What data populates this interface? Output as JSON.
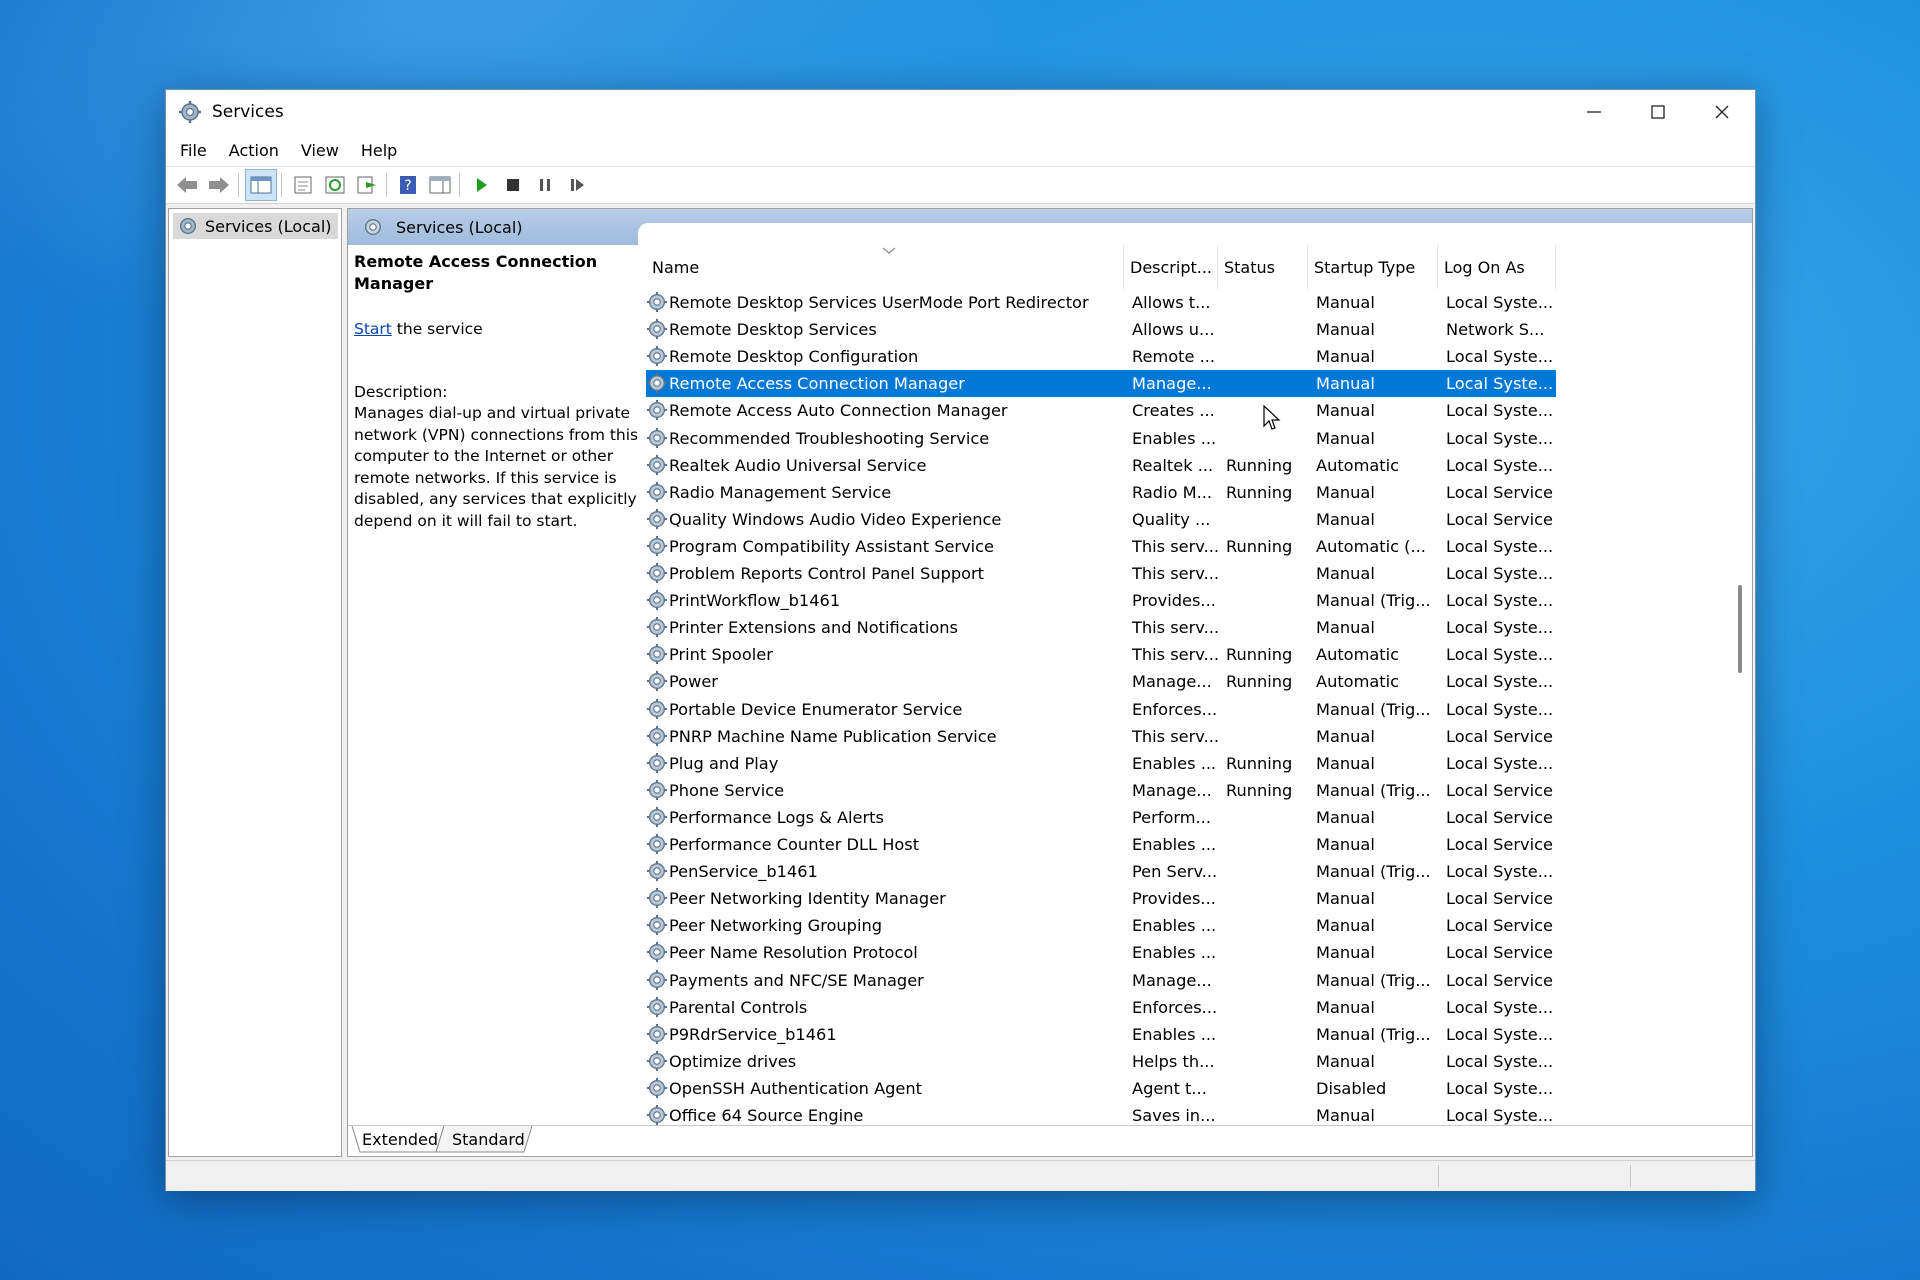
{
  "window": {
    "title": "Services"
  },
  "menu": [
    "File",
    "Action",
    "View",
    "Help"
  ],
  "tree": {
    "root_label": "Services (Local)"
  },
  "content_header": "Services (Local)",
  "details": {
    "service_name": "Remote Access Connection Manager",
    "start_link": "Start",
    "start_suffix": " the service",
    "description_label": "Description:",
    "description_text": "Manages dial-up and virtual private network (VPN) connections from this computer to the Internet or other remote networks. If this service is disabled, any services that explicitly depend on it will fail to start."
  },
  "columns": [
    "Name",
    "Descript...",
    "Status",
    "Startup Type",
    "Log On As"
  ],
  "rows": [
    [
      "Remote Desktop Services UserMode Port Redirector",
      "Allows t...",
      "",
      "Manual",
      "Local Syste..."
    ],
    [
      "Remote Desktop Services",
      "Allows u...",
      "",
      "Manual",
      "Network S..."
    ],
    [
      "Remote Desktop Configuration",
      "Remote ...",
      "",
      "Manual",
      "Local Syste..."
    ],
    [
      "Remote Access Connection Manager",
      "Manage...",
      "",
      "Manual",
      "Local Syste..."
    ],
    [
      "Remote Access Auto Connection Manager",
      "Creates ...",
      "",
      "Manual",
      "Local Syste..."
    ],
    [
      "Recommended Troubleshooting Service",
      "Enables ...",
      "",
      "Manual",
      "Local Syste..."
    ],
    [
      "Realtek Audio Universal Service",
      "Realtek ...",
      "Running",
      "Automatic",
      "Local Syste..."
    ],
    [
      "Radio Management Service",
      "Radio M...",
      "Running",
      "Manual",
      "Local Service"
    ],
    [
      "Quality Windows Audio Video Experience",
      "Quality ...",
      "",
      "Manual",
      "Local Service"
    ],
    [
      "Program Compatibility Assistant Service",
      "This serv...",
      "Running",
      "Automatic (...",
      "Local Syste..."
    ],
    [
      "Problem Reports Control Panel Support",
      "This serv...",
      "",
      "Manual",
      "Local Syste..."
    ],
    [
      "PrintWorkflow_b1461",
      "Provides...",
      "",
      "Manual (Trig...",
      "Local Syste..."
    ],
    [
      "Printer Extensions and Notifications",
      "This serv...",
      "",
      "Manual",
      "Local Syste..."
    ],
    [
      "Print Spooler",
      "This serv...",
      "Running",
      "Automatic",
      "Local Syste..."
    ],
    [
      "Power",
      "Manage...",
      "Running",
      "Automatic",
      "Local Syste..."
    ],
    [
      "Portable Device Enumerator Service",
      "Enforces...",
      "",
      "Manual (Trig...",
      "Local Syste..."
    ],
    [
      "PNRP Machine Name Publication Service",
      "This serv...",
      "",
      "Manual",
      "Local Service"
    ],
    [
      "Plug and Play",
      "Enables ...",
      "Running",
      "Manual",
      "Local Syste..."
    ],
    [
      "Phone Service",
      "Manage...",
      "Running",
      "Manual (Trig...",
      "Local Service"
    ],
    [
      "Performance Logs & Alerts",
      "Perform...",
      "",
      "Manual",
      "Local Service"
    ],
    [
      "Performance Counter DLL Host",
      "Enables ...",
      "",
      "Manual",
      "Local Service"
    ],
    [
      "PenService_b1461",
      "Pen Serv...",
      "",
      "Manual (Trig...",
      "Local Syste..."
    ],
    [
      "Peer Networking Identity Manager",
      "Provides...",
      "",
      "Manual",
      "Local Service"
    ],
    [
      "Peer Networking Grouping",
      "Enables ...",
      "",
      "Manual",
      "Local Service"
    ],
    [
      "Peer Name Resolution Protocol",
      "Enables ...",
      "",
      "Manual",
      "Local Service"
    ],
    [
      "Payments and NFC/SE Manager",
      "Manage...",
      "",
      "Manual (Trig...",
      "Local Service"
    ],
    [
      "Parental Controls",
      "Enforces...",
      "",
      "Manual",
      "Local Syste..."
    ],
    [
      "P9RdrService_b1461",
      "Enables ...",
      "",
      "Manual (Trig...",
      "Local Syste..."
    ],
    [
      "Optimize drives",
      "Helps th...",
      "",
      "Manual",
      "Local Syste..."
    ],
    [
      "OpenSSH Authentication Agent",
      "Agent t...",
      "",
      "Disabled",
      "Local Syste..."
    ],
    [
      "Office 64 Source Engine",
      "Saves in...",
      "",
      "Manual",
      "Local Syste..."
    ]
  ],
  "selected_row": 3,
  "tabs": [
    "Extended",
    "Standard"
  ],
  "colors": {
    "selection": "#0078d7",
    "header": "#a9c3e3"
  },
  "icons": [
    "services-gear-icon",
    "back-arrow-icon",
    "forward-arrow-icon",
    "play-icon",
    "stop-icon",
    "pause-icon",
    "resume-icon"
  ]
}
